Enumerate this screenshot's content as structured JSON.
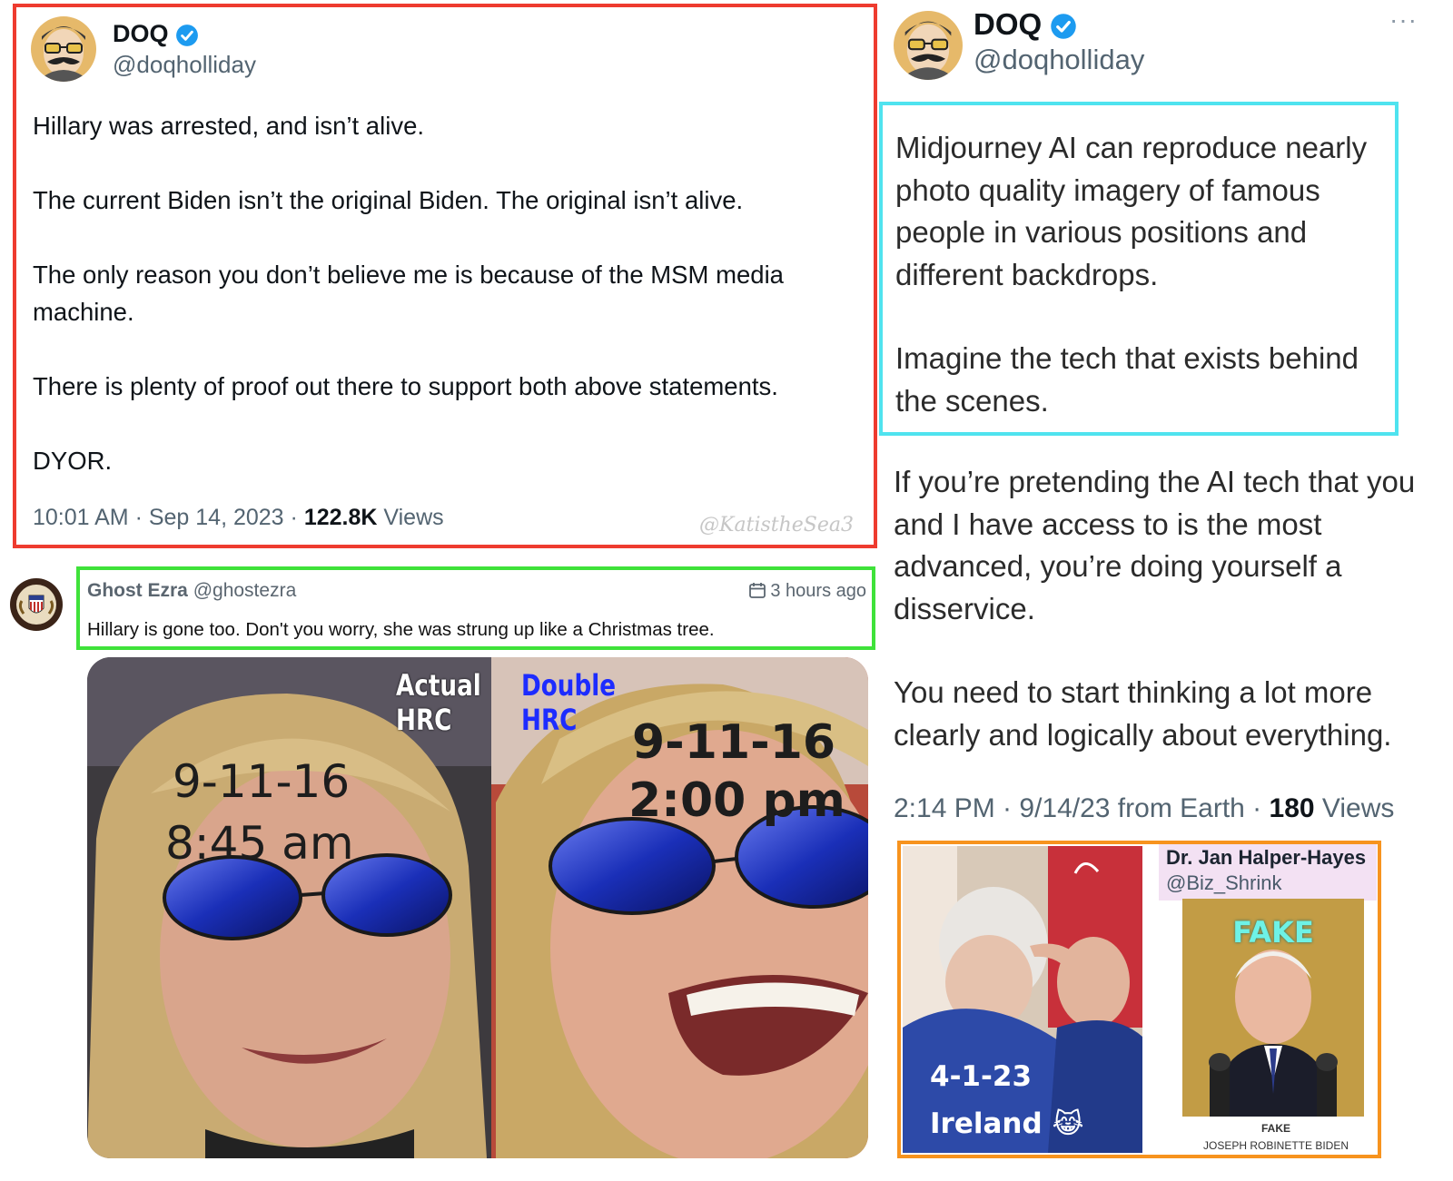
{
  "left_tweet": {
    "display_name": "DOQ",
    "handle": "@doqholliday",
    "paragraphs": [
      "Hillary was arrested, and isn’t alive.",
      "The current Biden isn’t the original Biden. The original isn’t alive.",
      "The only reason you don’t believe me is because of the MSM media machine.",
      "There is plenty of proof out there to support both above statements.",
      "DYOR."
    ],
    "meta_prefix": "10:01 AM · Sep 14, 2023 · ",
    "views_count": "122.8K",
    "views_label": " Views",
    "watermark": "@KatistheSea3"
  },
  "ezra_comment": {
    "name": "Ghost Ezra",
    "handle": "@ghostezra",
    "time": "3 hours ago",
    "text": "Hillary is gone too. Don't you worry, she was strung up like a Christmas tree."
  },
  "meme": {
    "actual_label_1": "Actual",
    "actual_label_2": "HRC",
    "double_label_1": "Double",
    "double_label_2": "HRC",
    "left_date": "9-11-16",
    "left_time": "8:45 am",
    "right_date": "9-11-16",
    "right_time": "2:00 pm"
  },
  "right_tweet": {
    "display_name": "DOQ",
    "handle": "@doqholliday",
    "more": "···",
    "p1": "Midjourney AI can reproduce nearly photo quality imagery of famous people in various positions and different backdrops.",
    "p2": "Imagine the tech that exists behind the scenes.",
    "p3": "If you’re pretending the AI tech that you and I have access to is the most advanced, you’re doing yourself a disservice.",
    "p4": "You need to start thinking a lot more clearly and logically about everything.",
    "meta_prefix": "2:14 PM · 9/14/23 from Earth · ",
    "views_count": "180",
    "views_label": " Views"
  },
  "biden_photo": {
    "date": "4-1-23",
    "place": "Ireland",
    "emoji": "😹"
  },
  "halper_post": {
    "name": "Dr. Jan Halper-Hayes",
    "handle": "@Biz_Shrink",
    "fake_label": "FAKE",
    "fake_small": "FAKE",
    "caption": "JOSEPH ROBINETTE BIDEN"
  },
  "colors": {
    "red_frame": "#ee3b2f",
    "green_frame": "#3fe23a",
    "cyan_frame": "#4fe3ef",
    "orange_frame": "#f7931e",
    "verified_blue": "#1d9bf0",
    "double_label_blue": "#1d2cff"
  }
}
